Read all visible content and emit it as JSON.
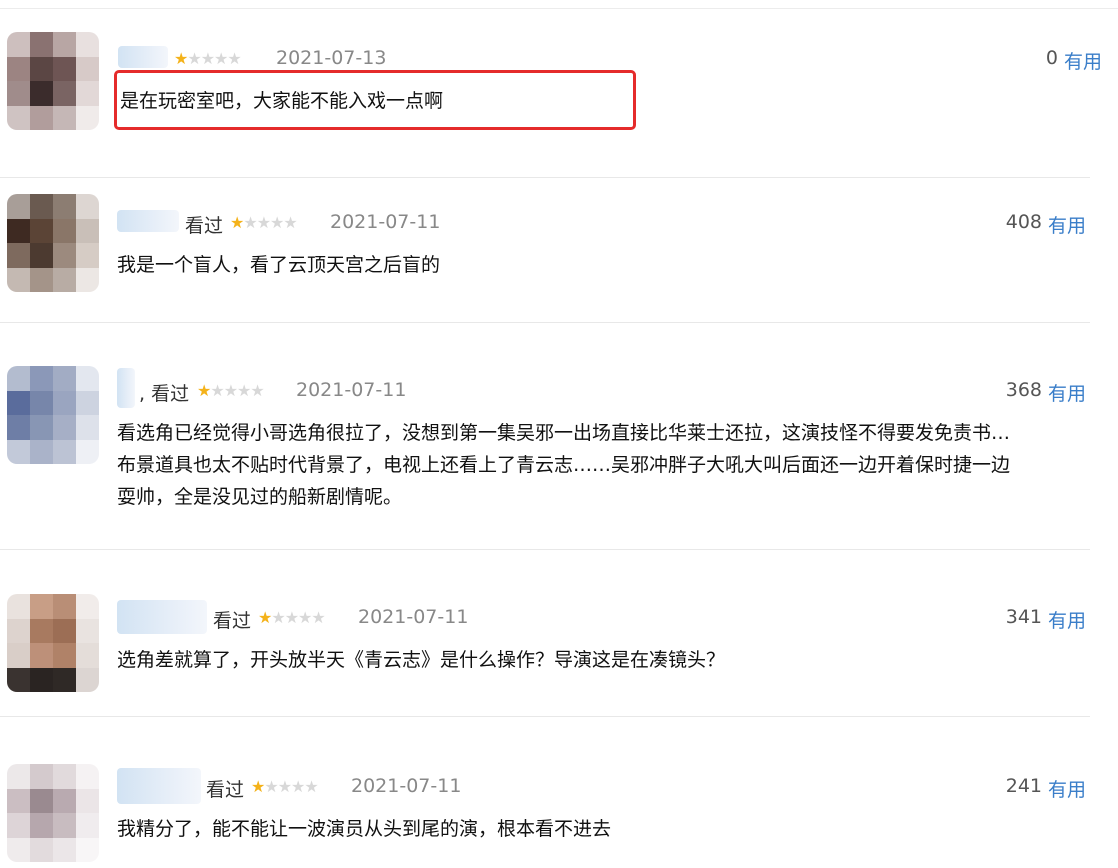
{
  "useful_label": "有用",
  "watched_label": "看过",
  "star_on": "★",
  "star_off": "★",
  "highlight_color": "#e52b2b",
  "star_color": "#f4b21a",
  "link_color": "#3a7ec9",
  "reviews": [
    {
      "rating": 1,
      "watched": "",
      "date": "2021-07-13",
      "useful_count": "0",
      "lines": [
        "是在玩密室吧，大家能不能入戏一点啊"
      ],
      "highlighted": true
    },
    {
      "rating": 1,
      "watched": "看过",
      "date": "2021-07-11",
      "useful_count": "408",
      "lines": [
        "我是一个盲人，看了云顶天宫之后盲的"
      ]
    },
    {
      "rating": 1,
      "watched": ", 看过",
      "date": "2021-07-11",
      "useful_count": "368",
      "lines": [
        "看选角已经觉得小哥选角很拉了，没想到第一集吴邪一出场直接比华莱士还拉，这演技怪不得要发免责书…",
        "布景道具也太不贴时代背景了，电视上还看上了青云志……吴邪冲胖子大吼大叫后面还一边开着保时捷一边",
        "耍帅，全是没见过的船新剧情呢。"
      ]
    },
    {
      "rating": 1,
      "watched": "看过",
      "date": "2021-07-11",
      "useful_count": "341",
      "lines": [
        "选角差就算了，开头放半天《青云志》是什么操作？导演这是在凑镜头？"
      ]
    },
    {
      "rating": 1,
      "watched": "看过",
      "date": "2021-07-11",
      "useful_count": "241",
      "lines": [
        "我精分了，能不能让一波演员从头到尾的演，根本看不进去"
      ]
    }
  ]
}
